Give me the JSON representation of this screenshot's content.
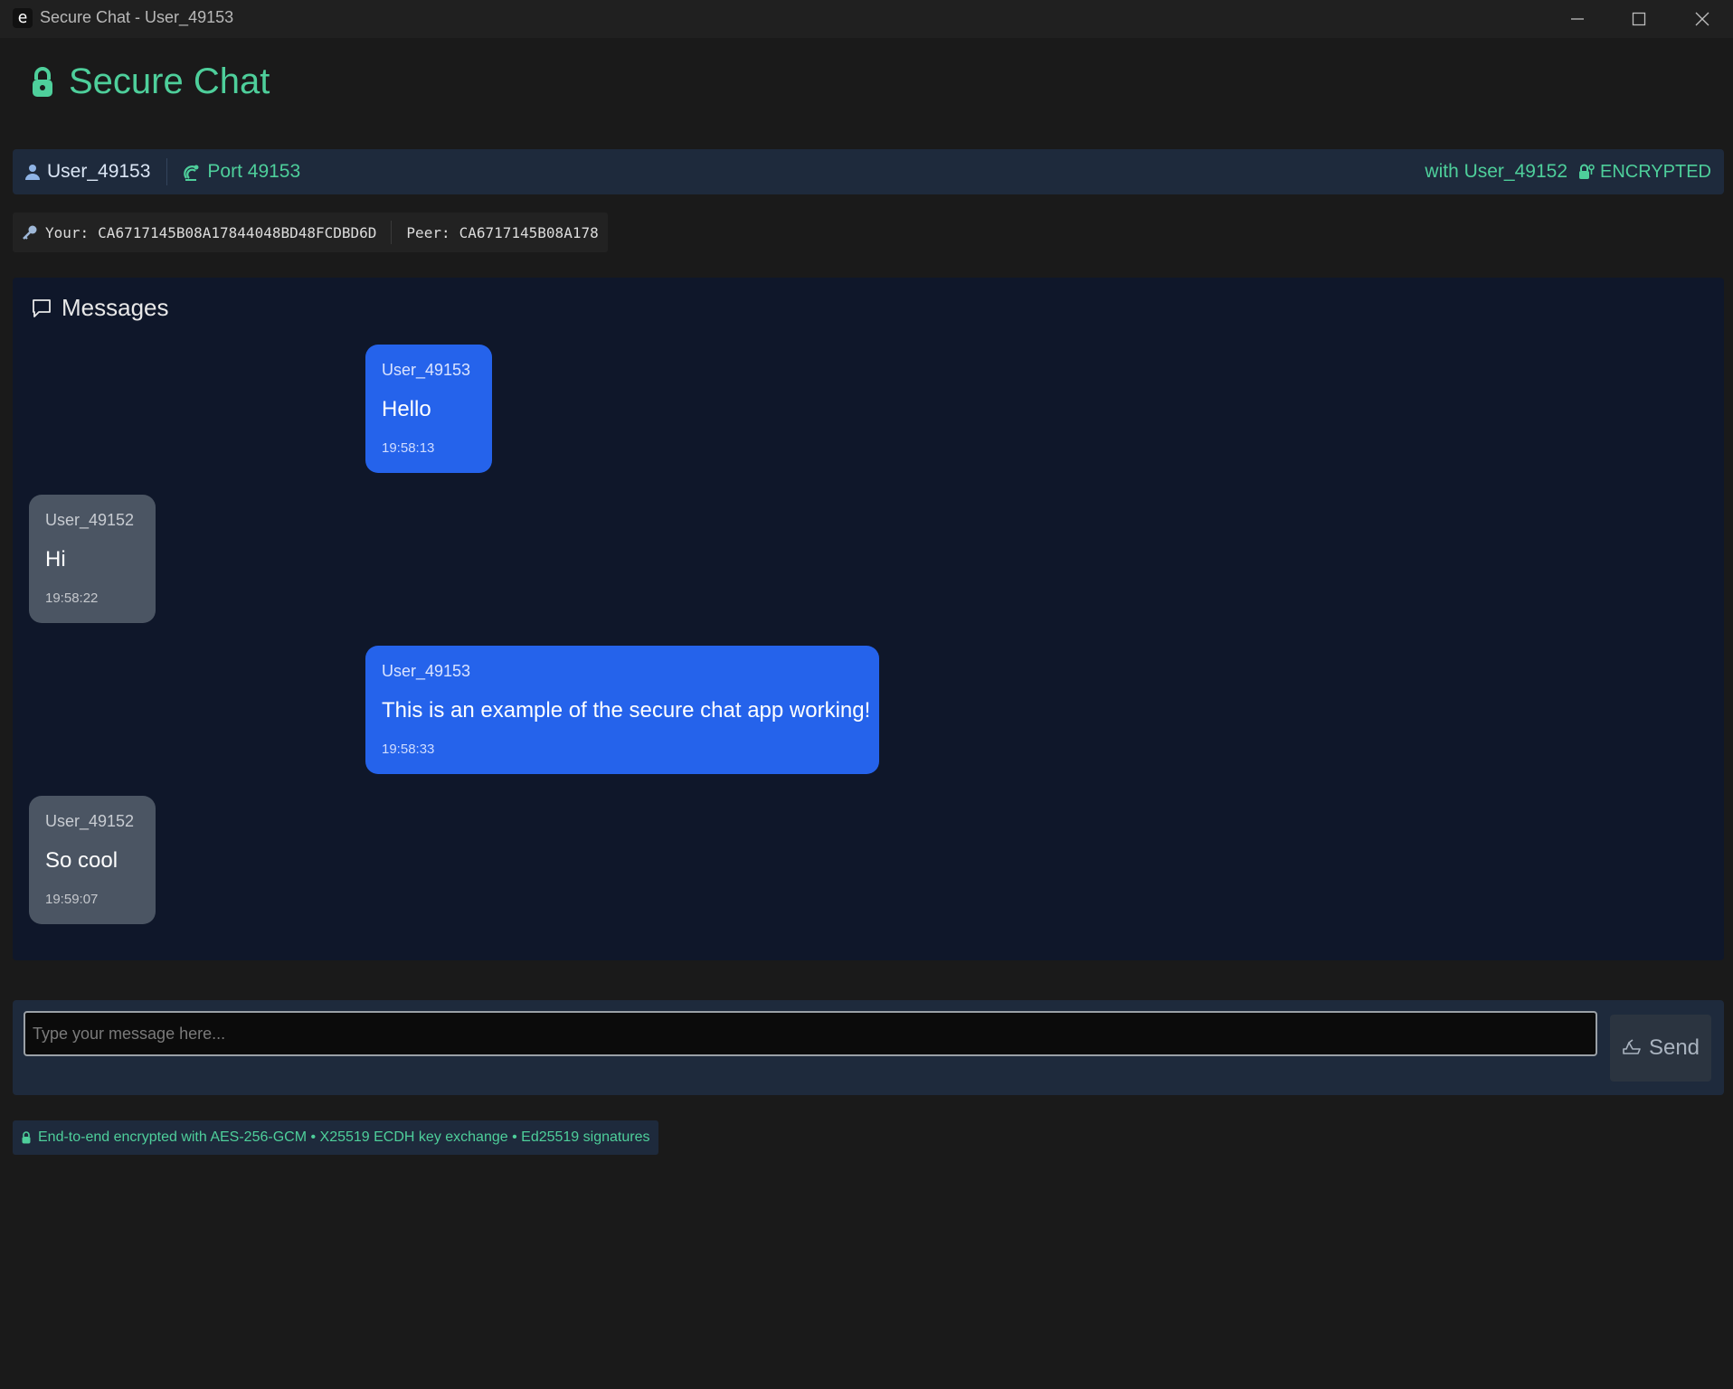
{
  "window": {
    "app_icon_glyph": "e",
    "title": "Secure Chat - User_49153"
  },
  "header": {
    "title": "Secure Chat",
    "icon": "lock-icon",
    "accent_color": "#4ecf9b"
  },
  "status_bar": {
    "user": "User_49153",
    "port": "Port 49153",
    "peer": "with User_49152",
    "encryption": "ENCRYPTED"
  },
  "keys": {
    "your_label": "Your:",
    "your_fingerprint": "CA6717145B08A17844048BD48FCDBD6D",
    "peer_label": "Peer:",
    "peer_fingerprint": "CA6717145B08A178"
  },
  "messages_panel": {
    "title": "Messages",
    "messages": [
      {
        "from": "own",
        "sender": "User_49153",
        "text": "Hello",
        "time": "19:58:13"
      },
      {
        "from": "peer",
        "sender": "User_49152",
        "text": "Hi",
        "time": "19:58:22"
      },
      {
        "from": "own",
        "sender": "User_49153",
        "text": "This is an example of the secure chat app working!",
        "time": "19:58:33"
      },
      {
        "from": "peer",
        "sender": "User_49152",
        "text": "So cool",
        "time": "19:59:07"
      }
    ]
  },
  "composer": {
    "placeholder": "Type your message here...",
    "value": "",
    "send_label": "Send"
  },
  "footer": {
    "note": "End-to-end encrypted with AES-256-GCM • X25519 ECDH key exchange • Ed25519 signatures"
  },
  "colors": {
    "own_bubble": "#2563eb",
    "peer_bubble": "#4b5563",
    "panel_bg": "#0f172a",
    "bar_bg": "#1e2a3c"
  }
}
